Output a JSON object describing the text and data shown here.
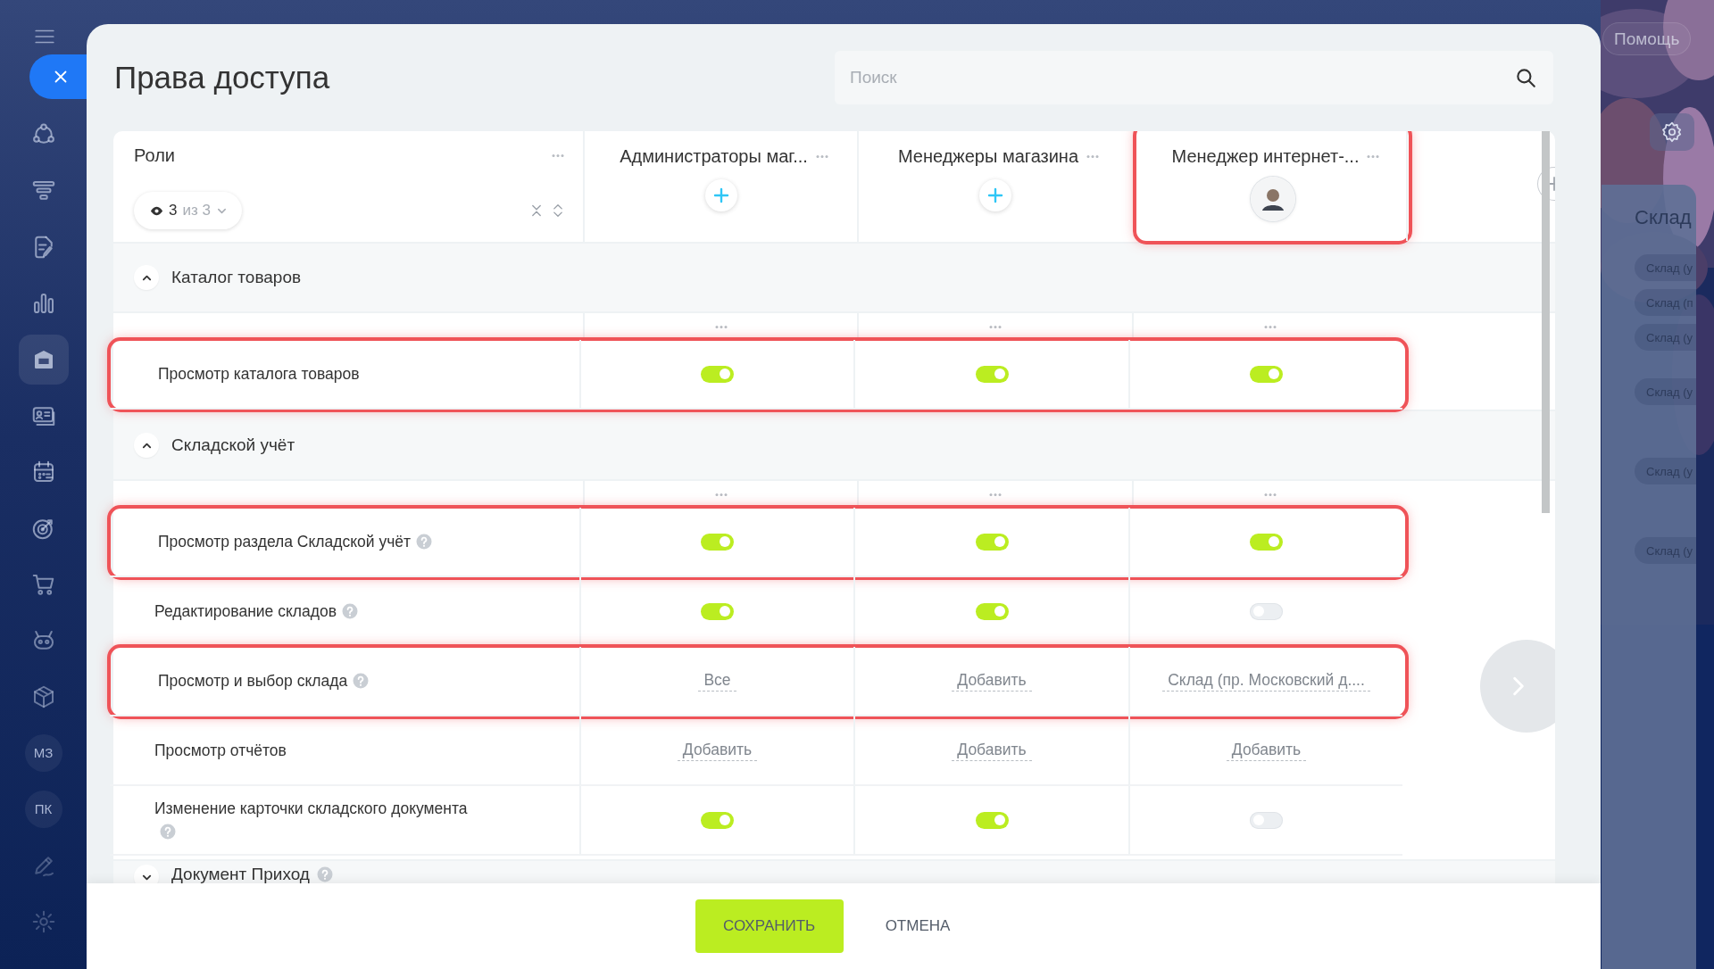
{
  "sidebar": {
    "items": [
      {
        "selected": false
      },
      {
        "selected": false
      },
      {
        "selected": false
      },
      {
        "selected": false
      },
      {
        "selected": true
      },
      {
        "selected": false
      },
      {
        "selected": false
      },
      {
        "selected": false
      },
      {
        "selected": false
      },
      {
        "selected": false
      },
      {
        "selected": false
      },
      {
        "selected": false,
        "label": "МЗ"
      },
      {
        "selected": false,
        "label": "ПК"
      },
      {
        "selected": false
      },
      {
        "selected": false
      }
    ]
  },
  "dialog": {
    "title": "Права доступа",
    "search": {
      "placeholder": "Поиск"
    }
  },
  "table": {
    "roles_header": {
      "title": "Роли",
      "filter": {
        "shown": "3",
        "total": "из 3"
      }
    },
    "columns": [
      {
        "title": "Администраторы маг...",
        "kind": "add",
        "highlighted": false
      },
      {
        "title": "Менеджеры магазина",
        "kind": "add",
        "highlighted": false
      },
      {
        "title": "Менеджер интернет-...",
        "kind": "avatar",
        "highlighted": true
      }
    ],
    "sections": [
      {
        "title": "Каталог товаров",
        "expanded": true,
        "help": false,
        "rows": [
          {
            "label": "Просмотр каталога товаров",
            "help": false,
            "highlighted": true,
            "cells": [
              {
                "kind": "toggle",
                "on": true
              },
              {
                "kind": "toggle",
                "on": true
              },
              {
                "kind": "toggle",
                "on": true
              }
            ]
          }
        ]
      },
      {
        "title": "Складской учёт",
        "expanded": true,
        "help": false,
        "rows": [
          {
            "label": "Просмотр раздела Складской учёт",
            "help": true,
            "highlighted": true,
            "cells": [
              {
                "kind": "toggle",
                "on": true
              },
              {
                "kind": "toggle",
                "on": true
              },
              {
                "kind": "toggle",
                "on": true
              }
            ]
          },
          {
            "label": "Редактирование складов",
            "help": true,
            "highlighted": false,
            "cells": [
              {
                "kind": "toggle",
                "on": true
              },
              {
                "kind": "toggle",
                "on": true
              },
              {
                "kind": "toggle",
                "on": false
              }
            ]
          },
          {
            "label": "Просмотр и выбор склада",
            "help": true,
            "highlighted": true,
            "cells": [
              {
                "kind": "link",
                "text": "Все"
              },
              {
                "kind": "link",
                "text": "Добавить"
              },
              {
                "kind": "link",
                "text": "Склад (пр. Московский д...."
              }
            ]
          },
          {
            "label": "Просмотр отчётов",
            "help": false,
            "highlighted": false,
            "cells": [
              {
                "kind": "link",
                "text": "Добавить"
              },
              {
                "kind": "link",
                "text": "Добавить"
              },
              {
                "kind": "link",
                "text": "Добавить"
              }
            ]
          },
          {
            "label": "Изменение карточки складского документа",
            "help": true,
            "highlighted": false,
            "cells": [
              {
                "kind": "toggle",
                "on": true
              },
              {
                "kind": "toggle",
                "on": true
              },
              {
                "kind": "toggle",
                "on": false
              }
            ]
          }
        ]
      },
      {
        "title": "Документ Приход",
        "expanded": false,
        "help": true
      }
    ]
  },
  "footer": {
    "buttons": [
      {
        "label": "СОХРАНИТЬ",
        "primary": true
      },
      {
        "label": "ОТМЕНА",
        "primary": false
      }
    ]
  },
  "background": {
    "help_button": "Помощь",
    "panel": {
      "title": "Склад",
      "chips": [
        "Склад (у",
        "Склад (п",
        "Склад (у",
        "Склад (у",
        "Склад (у",
        "Склад (у"
      ]
    }
  }
}
